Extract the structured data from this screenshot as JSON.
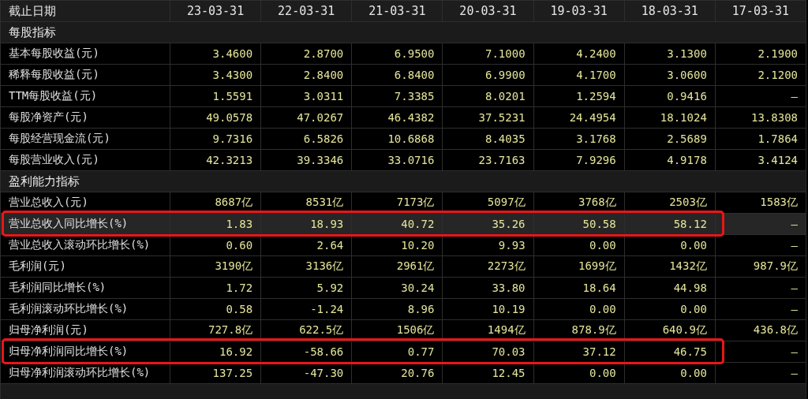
{
  "table": {
    "columns": [
      "截止日期",
      "23-03-31",
      "22-03-31",
      "21-03-31",
      "20-03-31",
      "19-03-31",
      "18-03-31",
      "17-03-31"
    ],
    "rows": [
      {
        "kind": "section",
        "label": "每股指标"
      },
      {
        "kind": "data",
        "label": "基本每股收益(元)",
        "values": [
          "3.4600",
          "2.8700",
          "6.9500",
          "7.1000",
          "4.2400",
          "3.1300",
          "2.1900"
        ],
        "selected": false,
        "outlined": false
      },
      {
        "kind": "data",
        "label": "稀释每股收益(元)",
        "values": [
          "3.4300",
          "2.8400",
          "6.8400",
          "6.9900",
          "4.1700",
          "3.0600",
          "2.1200"
        ],
        "selected": false,
        "outlined": false
      },
      {
        "kind": "data",
        "label": "TTM每股收益(元)",
        "values": [
          "1.5591",
          "3.0311",
          "7.3385",
          "8.0201",
          "1.2594",
          "0.9416",
          "—"
        ],
        "selected": false,
        "outlined": false
      },
      {
        "kind": "data",
        "label": "每股净资产(元)",
        "values": [
          "49.0578",
          "47.0267",
          "46.4382",
          "37.5231",
          "24.4954",
          "18.1024",
          "13.8308"
        ],
        "selected": false,
        "outlined": false
      },
      {
        "kind": "data",
        "label": "每股经营现金流(元)",
        "values": [
          "9.7316",
          "6.5826",
          "10.6868",
          "8.4035",
          "3.1768",
          "2.5689",
          "1.7864"
        ],
        "selected": false,
        "outlined": false
      },
      {
        "kind": "data",
        "label": "每股营业收入(元)",
        "values": [
          "42.3213",
          "39.3346",
          "33.0716",
          "23.7163",
          "7.9296",
          "4.9178",
          "3.4124"
        ],
        "selected": false,
        "outlined": false
      },
      {
        "kind": "section",
        "label": "盈利能力指标"
      },
      {
        "kind": "data",
        "label": "营业总收入(元)",
        "values": [
          "8687亿",
          "8531亿",
          "7173亿",
          "5097亿",
          "3768亿",
          "2503亿",
          "1583亿"
        ],
        "selected": false,
        "outlined": false
      },
      {
        "kind": "data",
        "label": "营业总收入同比增长(%)",
        "values": [
          "1.83",
          "18.93",
          "40.72",
          "35.26",
          "50.58",
          "58.12",
          "—"
        ],
        "selected": true,
        "outlined": true
      },
      {
        "kind": "data",
        "label": "营业总收入滚动环比增长(%)",
        "values": [
          "0.60",
          "2.64",
          "10.20",
          "9.93",
          "0.00",
          "0.00",
          "—"
        ],
        "selected": false,
        "outlined": false
      },
      {
        "kind": "data",
        "label": "毛利润(元)",
        "values": [
          "3190亿",
          "3136亿",
          "2961亿",
          "2273亿",
          "1699亿",
          "1432亿",
          "987.9亿"
        ],
        "selected": false,
        "outlined": false
      },
      {
        "kind": "data",
        "label": "毛利润同比增长(%)",
        "values": [
          "1.72",
          "5.92",
          "30.24",
          "33.80",
          "18.64",
          "44.98",
          "—"
        ],
        "selected": false,
        "outlined": false
      },
      {
        "kind": "data",
        "label": "毛利润滚动环比增长(%)",
        "values": [
          "0.58",
          "-1.24",
          "8.96",
          "10.19",
          "0.00",
          "0.00",
          "—"
        ],
        "selected": false,
        "outlined": false
      },
      {
        "kind": "data",
        "label": "归母净利润(元)",
        "values": [
          "727.8亿",
          "622.5亿",
          "1506亿",
          "1494亿",
          "878.9亿",
          "640.9亿",
          "436.8亿"
        ],
        "selected": false,
        "outlined": false
      },
      {
        "kind": "data",
        "label": "归母净利润同比增长(%)",
        "values": [
          "16.92",
          "-58.66",
          "0.77",
          "70.03",
          "37.12",
          "46.75",
          "—"
        ],
        "selected": false,
        "outlined": true
      },
      {
        "kind": "data",
        "label": "归母净利润滚动环比增长(%)",
        "values": [
          "137.25",
          "-47.30",
          "20.76",
          "12.45",
          "0.00",
          "0.00",
          "—"
        ],
        "selected": false,
        "outlined": false
      },
      {
        "kind": "section"
      }
    ]
  }
}
